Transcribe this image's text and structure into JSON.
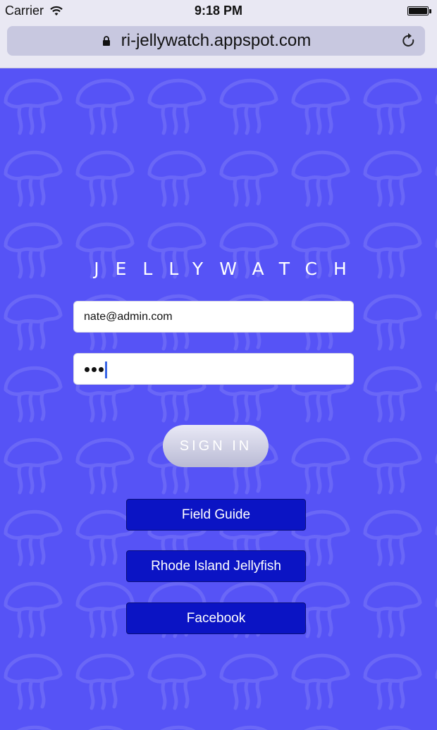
{
  "status_bar": {
    "carrier": "Carrier",
    "time": "9:18 PM",
    "wifi_icon": "wifi-icon",
    "battery_icon": "battery-icon"
  },
  "browser": {
    "url": "ri-jellywatch.appspot.com",
    "lock_icon": "lock-icon",
    "reload_icon": "reload-icon"
  },
  "login": {
    "title": "JELLYWATCH",
    "email_value": "nate@admin.com",
    "password_masked_length": 3,
    "sign_in_label": "SIGN IN"
  },
  "links": [
    {
      "label": "Field Guide"
    },
    {
      "label": "Rhode Island Jellyfish"
    },
    {
      "label": "Facebook"
    }
  ],
  "colors": {
    "background": "#5653f6",
    "pattern": "#6a67f7",
    "link_button": "#0b14c4",
    "caret": "#3a66e6"
  }
}
